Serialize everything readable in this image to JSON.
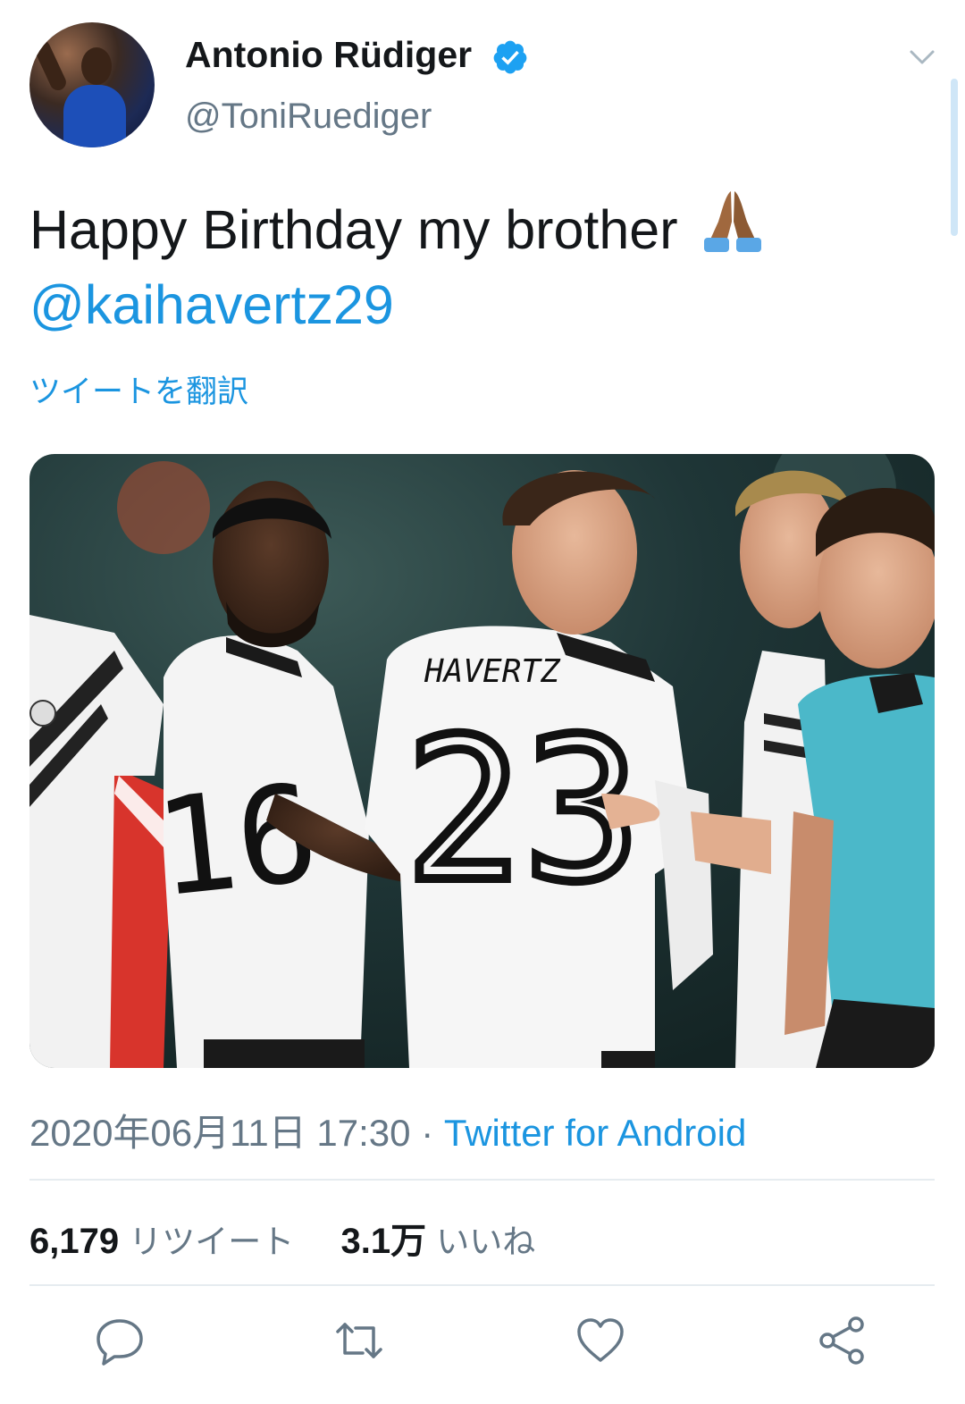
{
  "author": {
    "name": "Antonio Rüdiger",
    "handle": "@ToniRuediger",
    "verified_icon": "verified-badge-icon",
    "avatar_icon": "profile-avatar"
  },
  "tweet": {
    "text": "Happy Birthday my brother",
    "emoji": "folded-hands-emoji",
    "mention": "@kaihavertz29",
    "translate_label": "ツイートを翻訳"
  },
  "media": {
    "type": "photo",
    "jersey_name": "HAVERTZ",
    "jersey_number": "23"
  },
  "meta": {
    "timestamp": "2020年06月11日 17:30",
    "separator": " · ",
    "source": "Twitter for Android"
  },
  "stats": {
    "retweets_count": "6,179",
    "retweets_label": "リツイート",
    "likes_count": "3.1万",
    "likes_label": "いいね"
  },
  "actions": [
    "reply-icon",
    "retweet-icon",
    "like-icon",
    "share-icon"
  ],
  "colors": {
    "link": "#1b95e0",
    "secondary_text": "#657786",
    "primary_text": "#14171a",
    "divider": "#e6ecf0"
  }
}
